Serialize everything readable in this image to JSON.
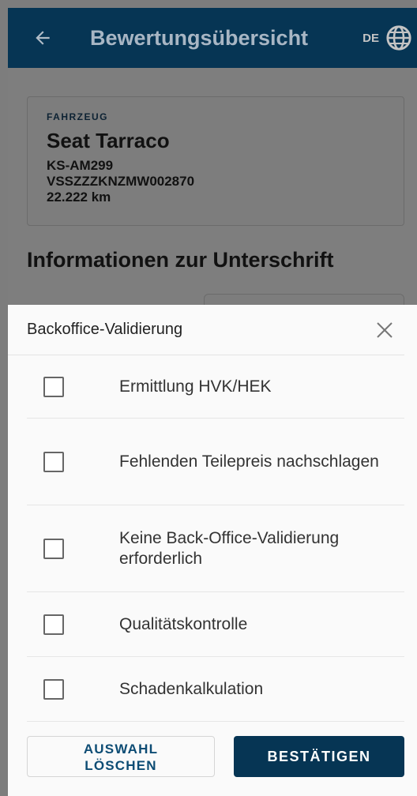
{
  "appbar": {
    "title": "Bewertungsübersicht",
    "language": "DE",
    "colors": {
      "background": "#063554"
    },
    "icons": {
      "back": "arrow-left-icon",
      "language": "globe-icon"
    }
  },
  "vehicle": {
    "overline": "FAHRZEUG",
    "name": "Seat Tarraco",
    "plate": "KS-AM299",
    "vin": "VSSZZZKNZMW002870",
    "mileage": "22.222 km"
  },
  "signature_section": {
    "heading": "Informationen zur Unterschrift"
  },
  "sheet": {
    "title": "Backoffice-Validierung",
    "close_icon": "close-icon",
    "options": [
      {
        "label": "Ermittlung HVK/HEK",
        "checked": false
      },
      {
        "label": "Fehlenden Teilepreis nachschlagen",
        "checked": false
      },
      {
        "label": "Keine Back-Office-Validierung erforderlich",
        "checked": false
      },
      {
        "label": "Qualitätskontrolle",
        "checked": false
      },
      {
        "label": "Schadenkalkulation",
        "checked": false
      }
    ],
    "clear_label_line1": "AUSWAHL",
    "clear_label_line2": "LÖSCHEN",
    "confirm_label": "BESTÄTIGEN",
    "colors": {
      "primary": "#063554",
      "secondary_text": "#0d4c74"
    }
  }
}
